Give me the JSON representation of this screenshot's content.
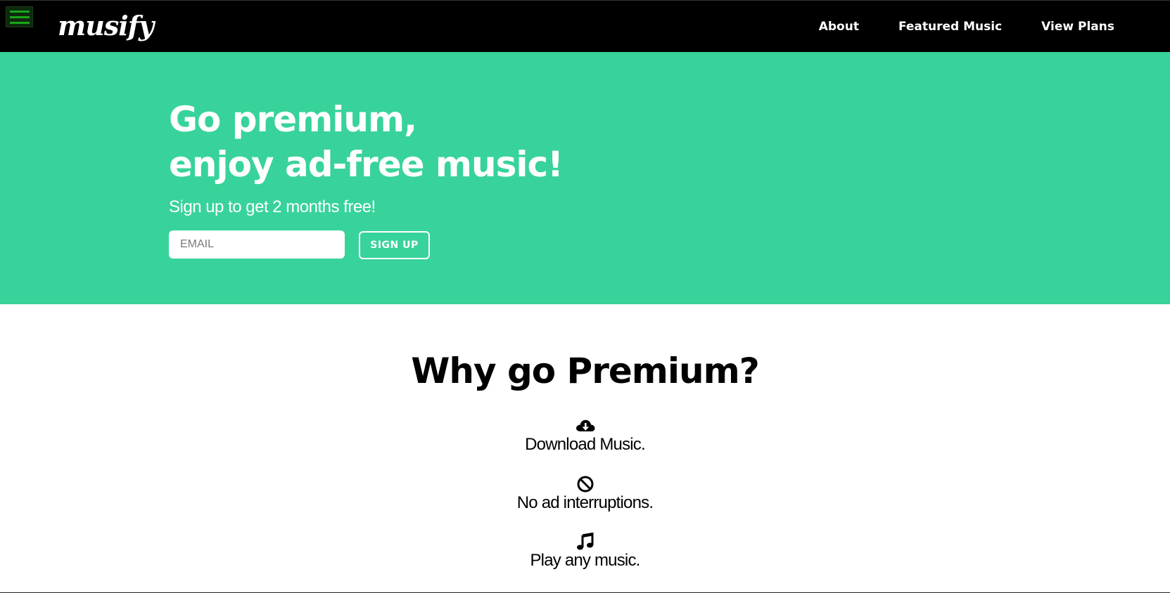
{
  "navbar": {
    "brand": "musify",
    "menu_icon": "hamburger-menu-icon",
    "links": [
      {
        "label": "About"
      },
      {
        "label": "Featured Music"
      },
      {
        "label": "View Plans"
      }
    ]
  },
  "hero": {
    "title_line1": "Go premium,",
    "title_line2": "enjoy ad-free music!",
    "subtitle": "Sign up to get 2 months free!",
    "email_placeholder": "EMAIL",
    "signup_label": "SIGN UP",
    "background_color": "#38d39a"
  },
  "features": {
    "title": "Why go Premium?",
    "items": [
      {
        "icon": "cloud-download-icon",
        "text": "Download Music."
      },
      {
        "icon": "ban-icon",
        "text": "No ad interruptions."
      },
      {
        "icon": "music-note-icon",
        "text": "Play any music."
      }
    ]
  }
}
